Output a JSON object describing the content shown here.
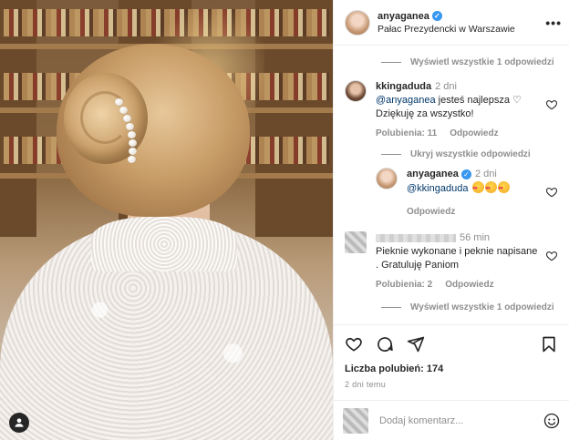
{
  "post": {
    "username": "anyaganea",
    "location": "Pałac Prezydencki w Warszawie",
    "more_label": "•••"
  },
  "comments": {
    "view_replies_top": "Wyświetl wszystkie 1 odpowiedzi",
    "c1": {
      "username": "kkingaduda",
      "time": "2 dni",
      "mention": "@anyaganea",
      "text_line1": " jesteś najlepsza ♡",
      "text_line2": "Dziękuję za wszystko!",
      "likes": "Polubienia: 11",
      "reply": "Odpowiedz"
    },
    "hide_replies": "Ukryj wszystkie odpowiedzi",
    "r1": {
      "username": "anyaganea",
      "time": "2 dni",
      "mention": "@kkingaduda",
      "reply": "Odpowiedz"
    },
    "c2": {
      "time": "56 min",
      "text_line1": "Pieknie wykonane i peknie napisane",
      "text_line2": ". Gratuluję Paniom",
      "likes": "Polubienia: 2",
      "reply": "Odpowiedz"
    },
    "view_replies_bottom": "Wyświetl wszystkie 1 odpowiedzi"
  },
  "actions": {
    "likes": "Liczba polubień: 174",
    "date": "2 dni temu"
  },
  "add_comment": {
    "placeholder": "Dodaj komentarz..."
  },
  "icons": [
    "heart-icon",
    "comment-icon",
    "share-icon",
    "bookmark-icon",
    "smiley-icon",
    "more-icon",
    "user-tag-icon"
  ],
  "colors": {
    "verified": "#3897f0",
    "mention": "#00376b",
    "muted": "#8e8e8e"
  }
}
